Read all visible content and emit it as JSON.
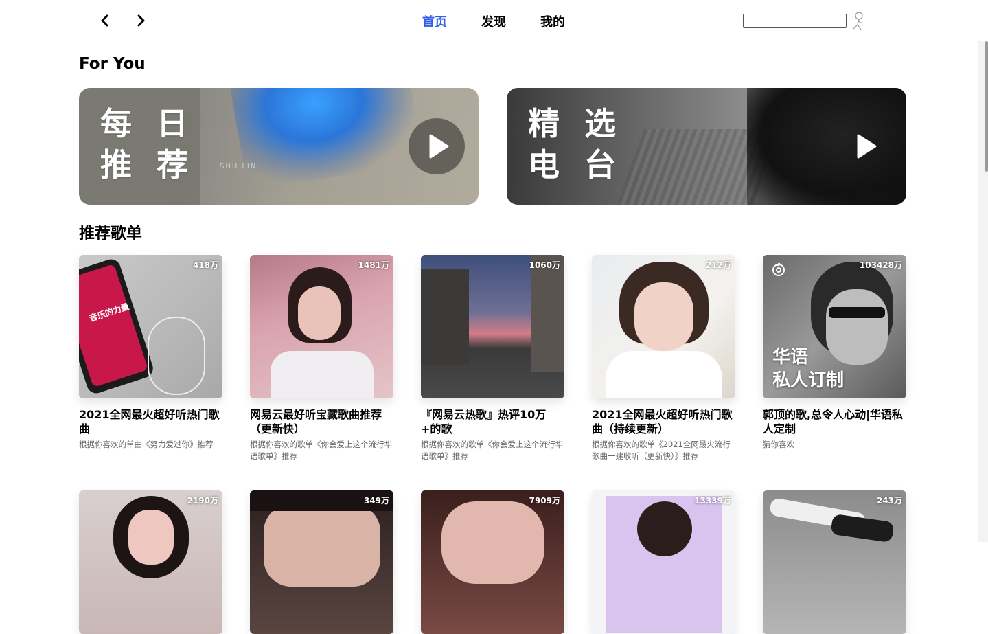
{
  "nav": {
    "back_icon": "chevron-left-icon",
    "forward_icon": "chevron-right-icon",
    "links": [
      {
        "label": "首页",
        "active": true
      },
      {
        "label": "发现",
        "active": false
      },
      {
        "label": "我的",
        "active": false
      }
    ],
    "active_color": "#335eea",
    "search": {
      "value": "",
      "placeholder": ""
    },
    "avatar_icon": "user-avatar-icon"
  },
  "for_you": {
    "title": "For You",
    "daily": {
      "line1": "每 日",
      "line2": "推 荐",
      "artist_caption": "SHU LIN"
    },
    "radio": {
      "line1": "精 选",
      "line2": "电 台"
    },
    "play_icon": "play-icon"
  },
  "playlists": {
    "title": "推荐歌单",
    "items": [
      {
        "count": "418万",
        "name": "2021全网最火超好听热门歌曲",
        "desc": "根据你喜欢的单曲《努力爱过你》推荐",
        "cover_text": "音乐的力量"
      },
      {
        "count": "1481万",
        "name": "网易云最好听宝藏歌曲推荐（更新快）",
        "desc": "根据你喜欢的歌单《你会爱上这个流行华语歌单》推荐",
        "cover_text": ""
      },
      {
        "count": "1060万",
        "name": "『网易云热歌』热评10万+的歌",
        "desc": "根据你喜欢的歌单《你会爱上这个流行华语歌单》推荐",
        "cover_text": ""
      },
      {
        "count": "212万",
        "name": "2021全网最火超好听热门歌曲（持续更新）",
        "desc": "根据你喜欢的歌单《2021全网最火流行歌曲一建收听（更新快）》推荐",
        "cover_text": ""
      },
      {
        "count": "103428万",
        "name": "郭顶的歌,总令人心动|华语私人定制",
        "desc": "猜你喜欢",
        "cover_text_line1": "华语",
        "cover_text_line2": "私人订制"
      }
    ],
    "row2_counts": [
      "2190万",
      "349万",
      "7909万",
      "13339万",
      "243万"
    ]
  }
}
